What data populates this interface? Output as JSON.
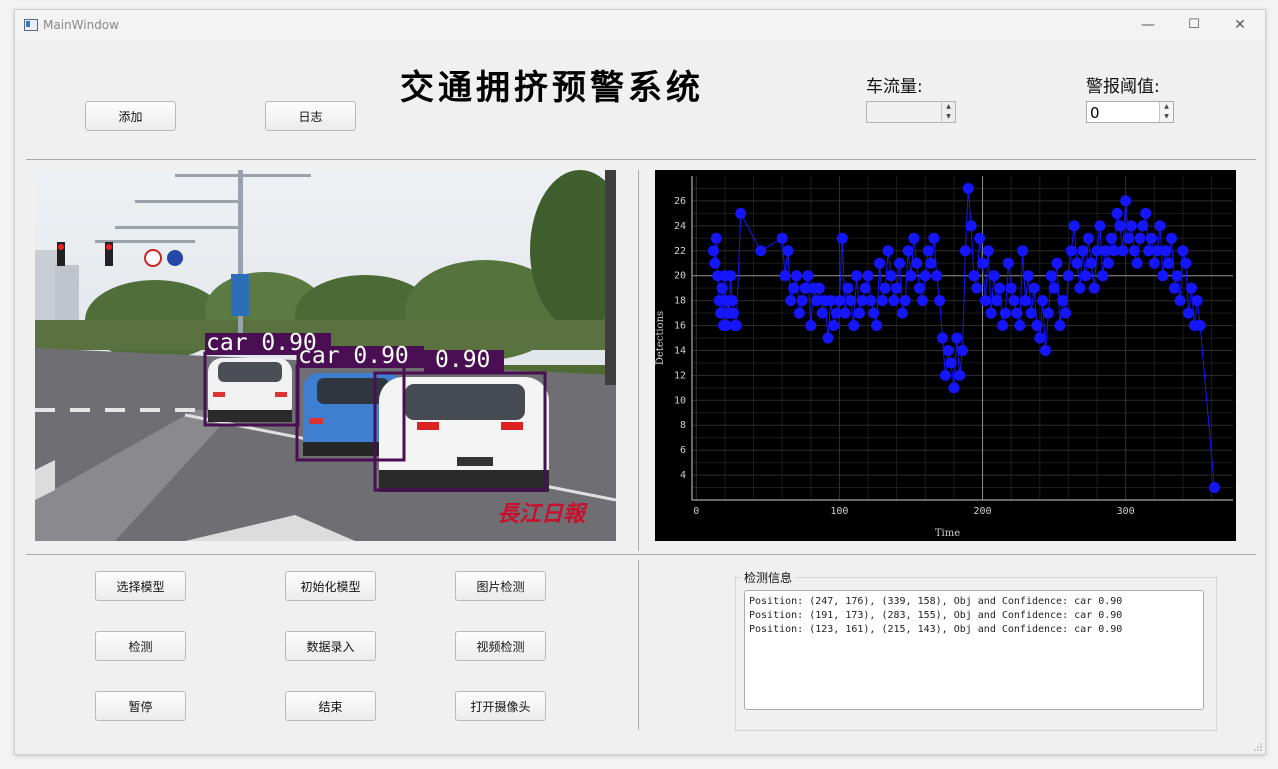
{
  "window": {
    "title": "MainWindow",
    "minimize": "—",
    "maximize": "☐",
    "close": "✕"
  },
  "header": {
    "title": "交通拥挤预警系统",
    "add_button": "添加",
    "log_button": "日志",
    "traffic_flow_label": "车流量:",
    "traffic_flow_value": "",
    "alarm_threshold_label": "警报阈值:",
    "alarm_threshold_value": "0"
  },
  "image_panel": {
    "detections": [
      {
        "label": "car 0.90"
      },
      {
        "label": "car 0.90"
      },
      {
        "label": "0.90"
      }
    ],
    "watermark": "長江日報"
  },
  "chart_data": {
    "type": "scatter",
    "xlabel": "Time",
    "ylabel": "Detections",
    "xlim": [
      -3,
      375
    ],
    "ylim": [
      2,
      28
    ],
    "xticks": [
      0,
      100,
      200,
      300
    ],
    "yticks": [
      4,
      6,
      8,
      10,
      12,
      14,
      16,
      18,
      20,
      22,
      24,
      26
    ],
    "grid": true,
    "colors": {
      "background": "#000000",
      "series": "#1515ff",
      "grid": "#2e2e2e",
      "axis": "#d0d0d0",
      "crosshair": "#8c8c8c"
    },
    "crosshair": {
      "x": 200,
      "y": 20
    },
    "series": [
      {
        "x": [
          12,
          13,
          14,
          15,
          16,
          17,
          18,
          19,
          20,
          21,
          22,
          23,
          24,
          25,
          26,
          27,
          28,
          31,
          45,
          60,
          62,
          64,
          66,
          68,
          70,
          72,
          74,
          76,
          78,
          80,
          82,
          84,
          86,
          88,
          90,
          92,
          94,
          96,
          98,
          100,
          102,
          104,
          106,
          108,
          110,
          112,
          114,
          116,
          118,
          120,
          122,
          124,
          126,
          128,
          130,
          132,
          134,
          136,
          138,
          140,
          142,
          144,
          146,
          148,
          150,
          152,
          154,
          156,
          158,
          160,
          162,
          164,
          166,
          168,
          170,
          172,
          174,
          176,
          178,
          180,
          182,
          184,
          186,
          188,
          190,
          192,
          194,
          196,
          198,
          200,
          202,
          204,
          206,
          208,
          210,
          212,
          214,
          216,
          218,
          220,
          222,
          224,
          226,
          228,
          230,
          232,
          234,
          236,
          238,
          240,
          242,
          244,
          246,
          248,
          250,
          252,
          254,
          256,
          258,
          260,
          262,
          264,
          266,
          268,
          270,
          272,
          274,
          276,
          278,
          280,
          282,
          284,
          286,
          288,
          290,
          292,
          294,
          296,
          298,
          300,
          302,
          304,
          306,
          308,
          310,
          312,
          314,
          316,
          318,
          320,
          322,
          324,
          326,
          328,
          330,
          332,
          334,
          336,
          338,
          340,
          342,
          344,
          346,
          348,
          350,
          352,
          362
        ],
        "y": [
          22,
          21,
          23,
          20,
          18,
          17,
          19,
          16,
          20,
          16,
          18,
          17,
          20,
          18,
          17,
          16,
          16,
          25,
          22,
          23,
          20,
          22,
          18,
          19,
          20,
          17,
          18,
          19,
          20,
          16,
          19,
          18,
          19,
          17,
          18,
          15,
          18,
          16,
          17,
          18,
          23,
          17,
          19,
          18,
          16,
          20,
          17,
          18,
          19,
          20,
          18,
          17,
          16,
          21,
          18,
          19,
          22,
          20,
          18,
          19,
          21,
          17,
          18,
          22,
          20,
          23,
          21,
          19,
          18,
          20,
          22,
          21,
          23,
          20,
          18,
          15,
          12,
          14,
          13,
          11,
          15,
          12,
          14,
          22,
          27,
          24,
          20,
          19,
          23,
          21,
          18,
          22,
          17,
          20,
          18,
          19,
          16,
          17,
          21,
          19,
          18,
          17,
          16,
          22,
          18,
          20,
          17,
          19,
          16,
          15,
          18,
          14,
          17,
          20,
          19,
          21,
          16,
          18,
          17,
          20,
          22,
          24,
          21,
          19,
          22,
          20,
          23,
          21,
          19,
          22,
          24,
          20,
          22,
          21,
          23,
          22,
          25,
          24,
          22,
          26,
          23,
          24,
          22,
          21,
          23,
          24,
          25,
          22,
          23,
          21,
          22,
          24,
          20,
          22,
          21,
          23,
          19,
          20,
          18,
          22,
          21,
          17,
          19,
          16,
          18,
          16,
          3
        ]
      }
    ]
  },
  "controls": {
    "select_model": "选择模型",
    "init_model": "初始化模型",
    "image_detect": "图片检测",
    "detect": "检测",
    "data_entry": "数据录入",
    "video_detect": "视频检测",
    "pause": "暂停",
    "stop": "结束",
    "open_camera": "打开摄像头"
  },
  "info": {
    "group_title": "检测信息",
    "lines": [
      "Position: (247, 176), (339, 158), Obj and Confidence: car 0.90",
      "Position: (191, 173), (283, 155), Obj and Confidence: car 0.90",
      "Position: (123, 161), (215, 143), Obj and Confidence: car 0.90"
    ]
  }
}
